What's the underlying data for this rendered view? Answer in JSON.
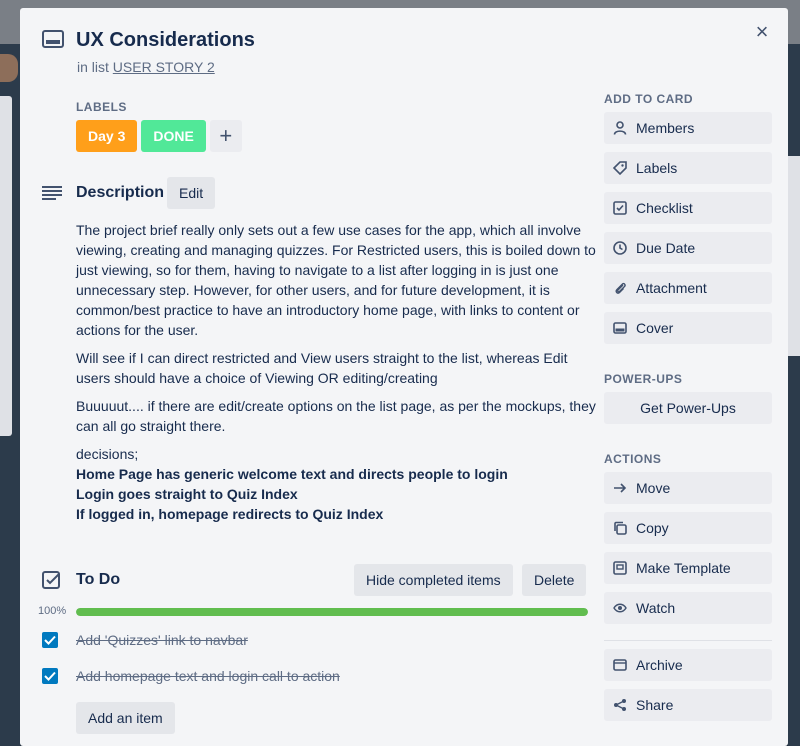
{
  "card": {
    "title": "UX Considerations",
    "in_list_prefix": "in list",
    "list_name": "USER STORY 2"
  },
  "labels": {
    "heading": "LABELS",
    "items": [
      {
        "text": "Day 3",
        "color": "#ff9f1a"
      },
      {
        "text": "DONE",
        "color": "#51e898"
      }
    ],
    "add_symbol": "+"
  },
  "description": {
    "title": "Description",
    "edit_label": "Edit",
    "paragraphs": [
      "The project brief really only sets out a few use cases for the app, which all involve viewing, creating and managing quizzes. For Restricted users, this is boiled down to just viewing, so for them, having to navigate to a list after logging in is just one unnecessary step. However, for other users, and for future development, it is common/best practice to have an introductory home page, with links to content or actions for the user.",
      "Will see if I can direct restricted and View users straight to the list, whereas Edit users should have a choice of Viewing OR editing/creating",
      "Buuuuut.... if there are edit/create options on the list page, as per the mockups, they can all go straight there."
    ],
    "decisions_intro": "decisions;",
    "decisions": [
      "Home Page has generic welcome text and directs people to login",
      "Login goes straight to Quiz Index",
      "If logged in, homepage redirects to Quiz Index"
    ]
  },
  "checklist": {
    "title": "To Do",
    "hide_label": "Hide completed items",
    "delete_label": "Delete",
    "progress_text": "100%",
    "progress_value": 1.0,
    "progress_color": "#61bd4f",
    "items": [
      {
        "text": "Add 'Quizzes' link to navbar",
        "checked": true
      },
      {
        "text": "Add homepage text and login call to action",
        "checked": true
      }
    ],
    "add_item_label": "Add an item"
  },
  "sidebar": {
    "add_to_card": {
      "heading": "ADD TO CARD",
      "buttons": [
        {
          "label": "Members",
          "icon": "person-icon"
        },
        {
          "label": "Labels",
          "icon": "tag-icon"
        },
        {
          "label": "Checklist",
          "icon": "checklist-icon"
        },
        {
          "label": "Due Date",
          "icon": "clock-icon"
        },
        {
          "label": "Attachment",
          "icon": "paperclip-icon"
        },
        {
          "label": "Cover",
          "icon": "cover-icon"
        }
      ]
    },
    "power_ups": {
      "heading": "POWER-UPS",
      "button": "Get Power-Ups"
    },
    "actions": {
      "heading": "ACTIONS",
      "buttons": [
        {
          "label": "Move",
          "icon": "arrow-right-icon"
        },
        {
          "label": "Copy",
          "icon": "copy-icon"
        },
        {
          "label": "Make Template",
          "icon": "template-icon"
        },
        {
          "label": "Watch",
          "icon": "eye-icon"
        },
        {
          "label": "Archive",
          "icon": "archive-icon"
        },
        {
          "label": "Share",
          "icon": "share-icon"
        }
      ]
    }
  },
  "close_symbol": "×"
}
